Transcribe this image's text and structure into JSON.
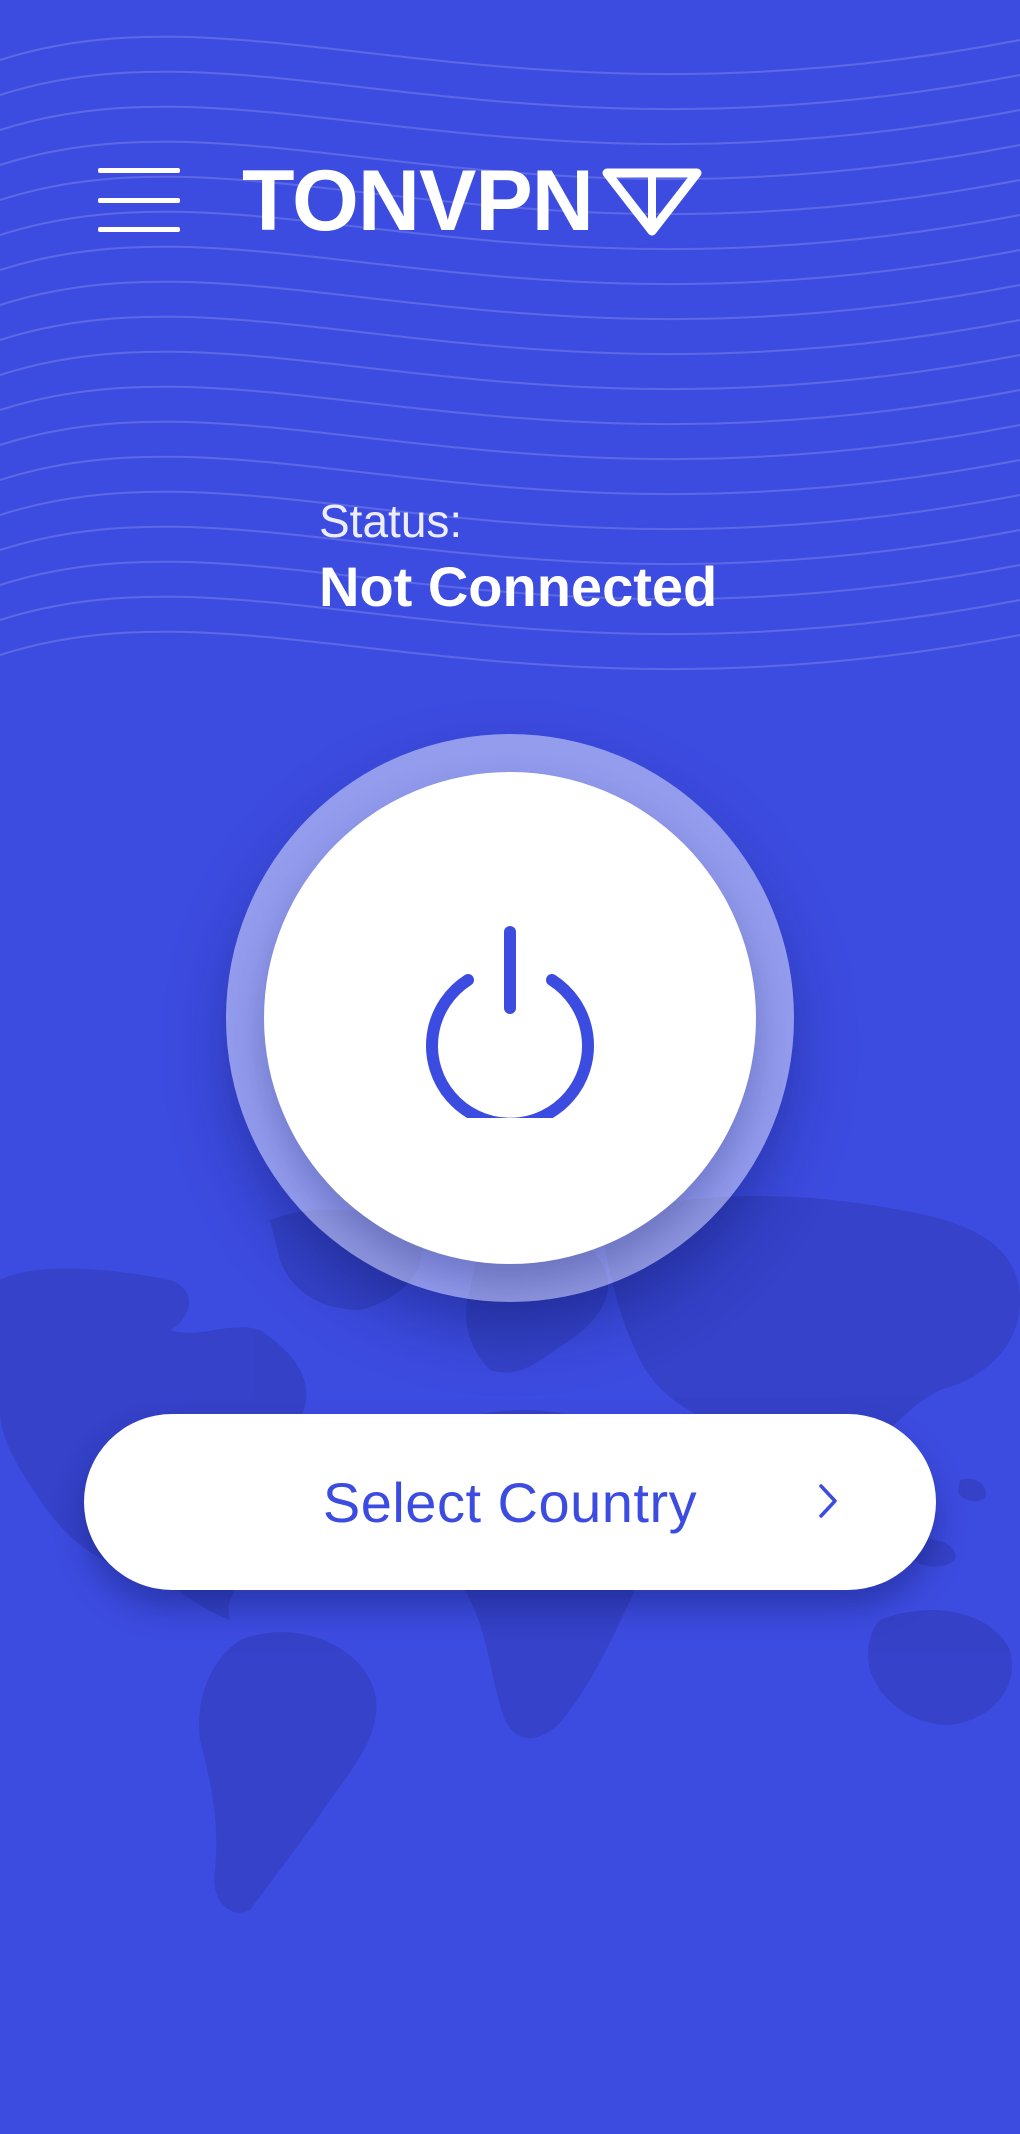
{
  "app": {
    "logo_text": "TONVPN"
  },
  "icons": {
    "menu": "hamburger-menu-icon",
    "logo_mark": "tonvpn-triangle-icon",
    "power": "power-icon",
    "chevron": "chevron-right-icon"
  },
  "status": {
    "label": "Status:",
    "value": "Not Connected"
  },
  "country_selector": {
    "label": "Select Country"
  },
  "colors": {
    "background": "#3d4ce0",
    "accent": "#3d4ce0",
    "text_on_bg": "#ffffff",
    "button_bg": "#ffffff"
  }
}
